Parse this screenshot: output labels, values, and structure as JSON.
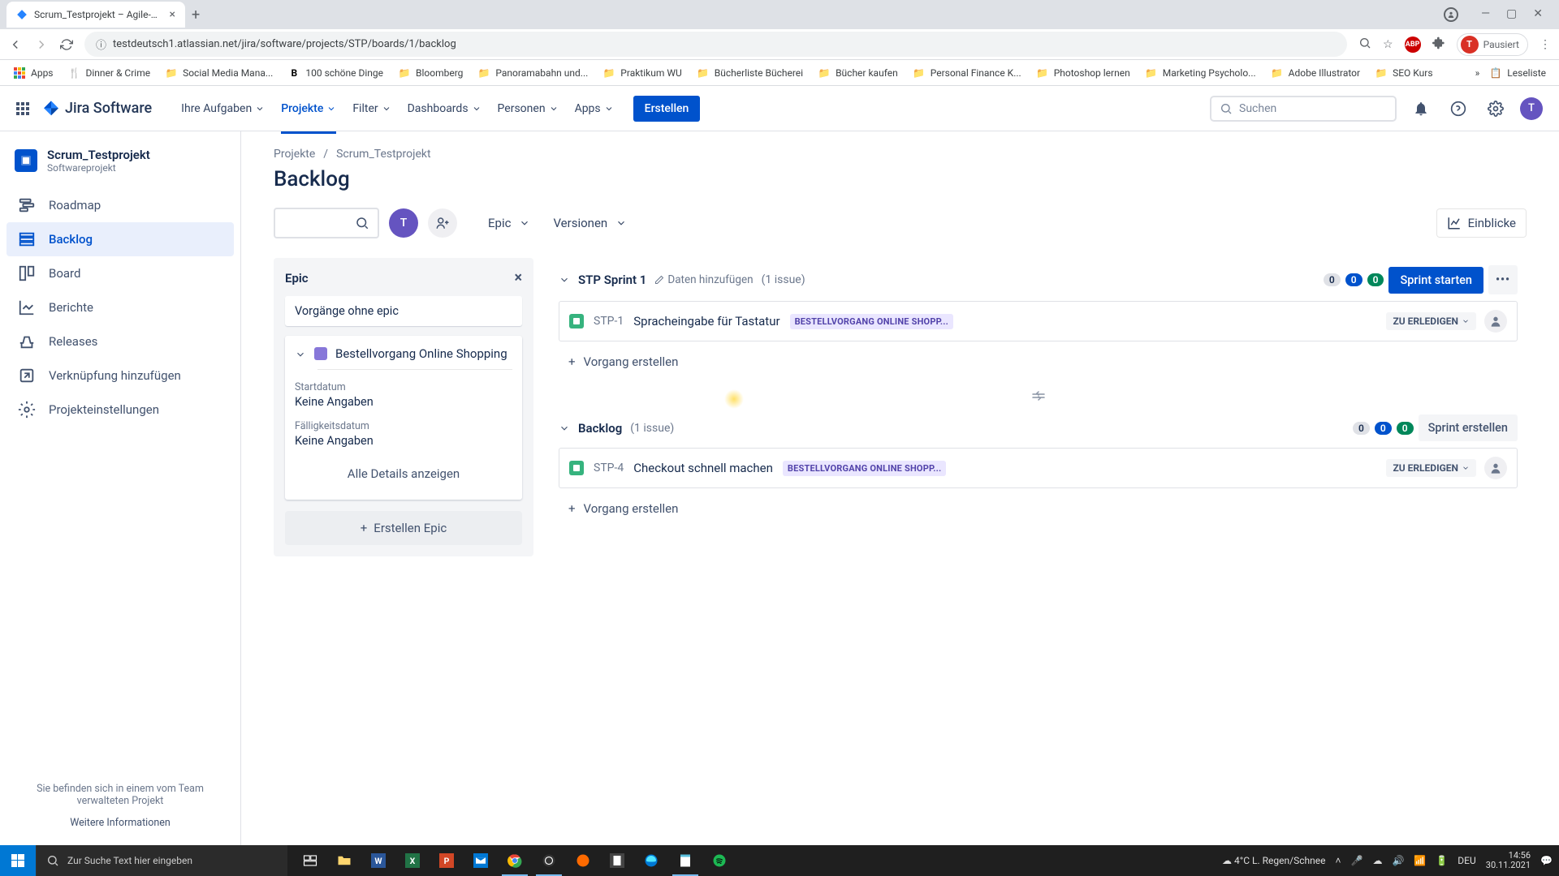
{
  "browser": {
    "tab_title": "Scrum_Testprojekt – Agile-Board",
    "url": "testdeutsch1.atlassian.net/jira/software/projects/STP/boards/1/backlog",
    "profile_status": "Pausiert",
    "profile_letter": "T"
  },
  "bookmarks": {
    "apps": "Apps",
    "items": [
      "Dinner & Crime",
      "Social Media Mana...",
      "100 schöne Dinge",
      "Bloomberg",
      "Panoramabahn und...",
      "Praktikum WU",
      "Bücherliste Bücherei",
      "Bücher kaufen",
      "Personal Finance K...",
      "Photoshop lernen",
      "Marketing Psycholo...",
      "Adobe Illustrator",
      "SEO Kurs"
    ],
    "reading_list": "Leseliste"
  },
  "topnav": {
    "product": "Jira Software",
    "your_work": "Ihre Aufgaben",
    "projects": "Projekte",
    "filters": "Filter",
    "dashboards": "Dashboards",
    "people": "Personen",
    "apps": "Apps",
    "create": "Erstellen",
    "search_placeholder": "Suchen",
    "avatar_letter": "T"
  },
  "sidebar": {
    "project_name": "Scrum_Testprojekt",
    "project_type": "Softwareprojekt",
    "items": {
      "roadmap": "Roadmap",
      "backlog": "Backlog",
      "board": "Board",
      "reports": "Berichte",
      "releases": "Releases",
      "add_link": "Verknüpfung hinzufügen",
      "settings": "Projekteinstellungen"
    },
    "footer_text": "Sie befinden sich in einem vom Team verwalteten Projekt",
    "footer_link": "Weitere Informationen"
  },
  "breadcrumb": {
    "projects": "Projekte",
    "project": "Scrum_Testprojekt"
  },
  "page": {
    "title": "Backlog"
  },
  "toolbar": {
    "avatar_letter": "T",
    "epic": "Epic",
    "versions": "Versionen",
    "insights": "Einblicke"
  },
  "epic_panel": {
    "title": "Epic",
    "no_epic": "Vorgänge ohne epic",
    "epic_name": "Bestellvorgang Online Shopping",
    "start_label": "Startdatum",
    "start_value": "Keine Angaben",
    "due_label": "Fälligkeitsdatum",
    "due_value": "Keine Angaben",
    "details_btn": "Alle Details anzeigen",
    "create_epic": "Erstellen Epic"
  },
  "sprint": {
    "name": "STP Sprint 1",
    "add_dates": "Daten hinzufügen",
    "count": "(1 issue)",
    "pills": [
      "0",
      "0",
      "0"
    ],
    "start": "Sprint starten",
    "issue": {
      "key": "STP-1",
      "summary": "Spracheingabe für Tastatur",
      "epic": "BESTELLVORGANG ONLINE SHOPP...",
      "status": "ZU ERLEDIGEN"
    },
    "create_issue": "Vorgang erstellen"
  },
  "backlog": {
    "name": "Backlog",
    "count": "(1 issue)",
    "pills": [
      "0",
      "0",
      "0"
    ],
    "create_sprint": "Sprint erstellen",
    "issue": {
      "key": "STP-4",
      "summary": "Checkout schnell machen",
      "epic": "BESTELLVORGANG ONLINE SHOPP...",
      "status": "ZU ERLEDIGEN"
    },
    "create_issue": "Vorgang erstellen"
  },
  "taskbar": {
    "search_placeholder": "Zur Suche Text hier eingeben",
    "weather": "4°C  L. Regen/Schnee",
    "lang": "DEU",
    "time": "14:56",
    "date": "30.11.2021"
  }
}
